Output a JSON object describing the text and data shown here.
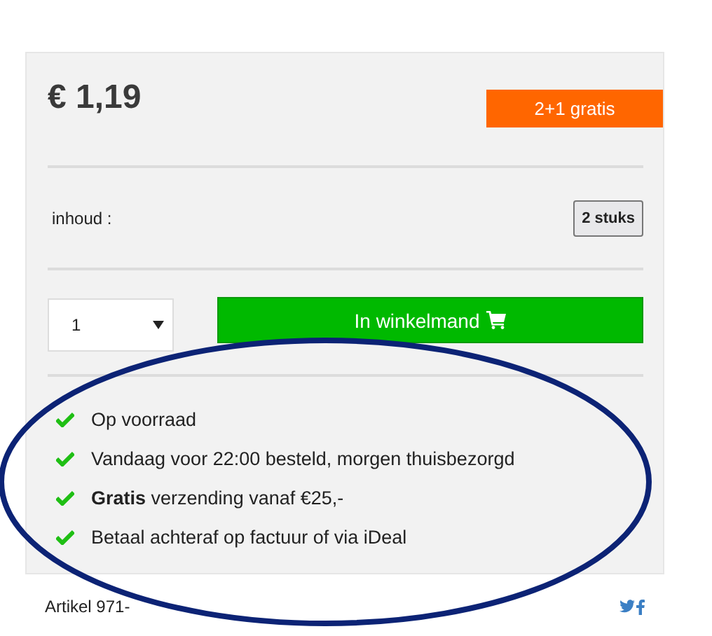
{
  "price": "€ 1,19",
  "badge": "2+1 gratis",
  "content": {
    "label": "inhoud :",
    "value": "2 stuks"
  },
  "quantity": {
    "value": "1"
  },
  "cart_button": "In winkelmand",
  "features": [
    {
      "text": "Op voorraad"
    },
    {
      "text": "Vandaag voor 22:00 besteld, morgen thuisbezorgd"
    },
    {
      "text": "**Gratis** verzending vanaf €25,-"
    },
    {
      "text": "Betaal achteraf op factuur of via iDeal"
    }
  ],
  "article": "Artikel 971-"
}
